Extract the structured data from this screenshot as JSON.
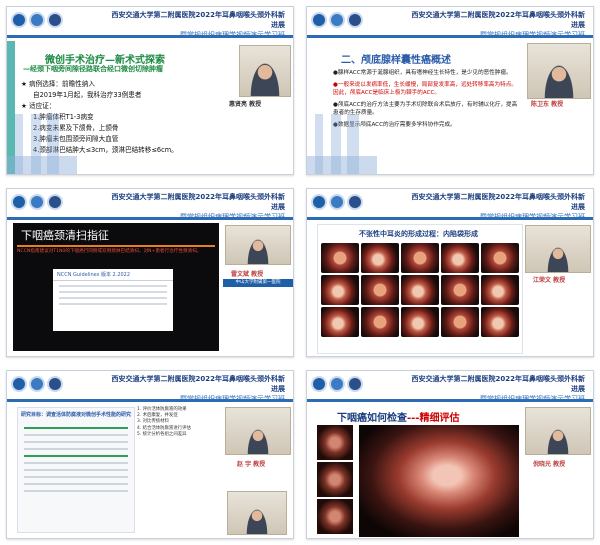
{
  "header": {
    "title_line1": "西安交通大学第二附属医院2022年耳鼻咽喉头颈外科新进展",
    "title_line2": "暨常规组织病理学视频演示学习班"
  },
  "slide1": {
    "title": "微创手术治疗—新术式探索",
    "subtitle": "—经颈下咽旁间隙径路联合经口微创切除肿瘤",
    "items": [
      "★ 病例选择：前瞻性纳入",
      "自2019年1月起，我科治疗33例患者",
      "★ 适应证：",
      "1.肿瘤体积T1-3病变",
      "2.病变未累及下颌骨，上颌骨",
      "3.肿瘤未包围颈旁间隙大血管",
      "4.颈部淋巴结肿大≤3cm，颈淋巴结转移≤6cm。"
    ],
    "speaker": "惠贤亮 教授"
  },
  "slide2": {
    "title": "二、颅底腺样囊性癌概述",
    "paragraphs": [
      "●腺样ACC常源于涎腺组织，具有嗜神经生长特性，是少见的恶性肿瘤。",
      "●一般来说以发病率低，生长缓慢，局部复发率高，远处转移率高为特点。因此，颅底ACC是临床上极为棘手的ACC。",
      "●颅底ACC的治疗方法主要为手术切除联合术后放疗，有时辅以化疗，提高患者的生存质量。",
      "●数据显示颅底ACC的治疗需要多学科协作完成。"
    ],
    "speaker": "陈卫东 教授"
  },
  "slide3": {
    "title": "下咽癌颈清扫指征",
    "text": "NCCN指南建议对T1N0的下咽癌行同侧或双侧颈淋巴结清扫，对N+患者行治疗性颈清扫。",
    "doc_title": "NCCN Guidelines 版本 2.2022",
    "speaker": "雷文斌 教授",
    "info": "中山大学附属第一医院"
  },
  "slide4": {
    "title": "不张性中耳炎的形成过程：内陷袋形成",
    "speaker": "江荣文 教授"
  },
  "slide5": {
    "doc_title": "研究目标：调查活体防腐液对微创手术性能的研究",
    "list": [
      "1. 评价活体防腐液的效果",
      "2. 术后康复，并发症",
      "3. 对比传统材料",
      "4. 结合活体防腐液进行评估",
      "5. 统计分析各组之间差异"
    ],
    "speaker": "赵 宇 教授"
  },
  "slide6": {
    "title_main": "下咽癌如何检查",
    "title_accent": "---精细评估",
    "speaker": "倪晓光 教授"
  }
}
